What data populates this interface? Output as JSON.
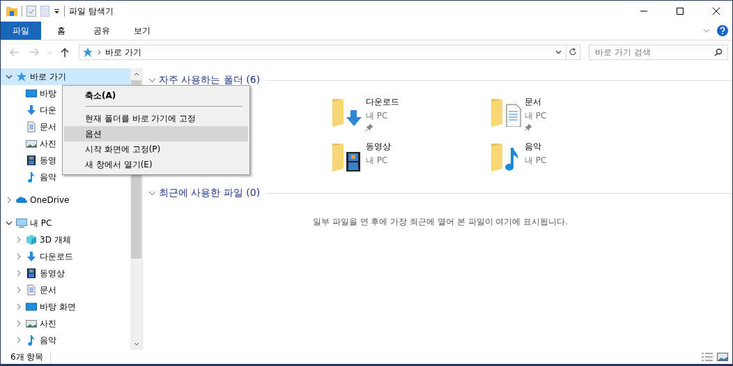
{
  "window": {
    "title": "파일 탐색기"
  },
  "ribbon": {
    "tabs": [
      {
        "label": "파일",
        "kind": "file",
        "selected": false
      },
      {
        "label": "홈",
        "kind": "tab",
        "selected": false
      },
      {
        "label": "공유",
        "kind": "tab",
        "selected": false
      },
      {
        "label": "보기",
        "kind": "tab",
        "selected": false
      }
    ]
  },
  "navigation": {
    "back_disabled": true,
    "forward_disabled": true,
    "address": "바로 가기",
    "search": {
      "placeholder": "바로 가기 검색"
    }
  },
  "sidebar": {
    "items": [
      {
        "label": "바로 가기",
        "kind": "star",
        "expanded": true,
        "selected": true,
        "children": [
          {
            "label": "바탕",
            "kind": "desktop",
            "selected": false
          },
          {
            "label": "다운",
            "kind": "download",
            "selected": false
          },
          {
            "label": "문서",
            "kind": "document",
            "selected": false
          },
          {
            "label": "사진",
            "kind": "picture",
            "selected": false
          },
          {
            "label": "동영",
            "kind": "video",
            "selected": false
          },
          {
            "label": "음악",
            "kind": "music",
            "selected": false
          }
        ]
      },
      {
        "label": "OneDrive",
        "kind": "cloud",
        "expanded": false,
        "selected": false
      },
      {
        "label": "내 PC",
        "kind": "pc",
        "expanded": true,
        "selected": false,
        "children": [
          {
            "label": "3D 개체",
            "kind": "cube",
            "expanded": false,
            "selected": false
          },
          {
            "label": "다운로드",
            "kind": "download",
            "expanded": false,
            "selected": false
          },
          {
            "label": "동영상",
            "kind": "video",
            "expanded": false,
            "selected": false
          },
          {
            "label": "문서",
            "kind": "document",
            "expanded": false,
            "selected": false
          },
          {
            "label": "바탕 화면",
            "kind": "desktop",
            "expanded": false,
            "selected": false
          },
          {
            "label": "사진",
            "kind": "picture",
            "expanded": false,
            "selected": false
          },
          {
            "label": "음악",
            "kind": "music",
            "expanded": false,
            "selected": false
          }
        ]
      }
    ]
  },
  "context_menu": {
    "items": [
      {
        "label": "축소(A)",
        "kind": "default",
        "selected": false
      },
      {
        "kind": "separator"
      },
      {
        "label": "현재 폴더를 바로 가기에 고정",
        "kind": "item",
        "selected": false
      },
      {
        "label": "옵션",
        "kind": "item",
        "selected": true
      },
      {
        "label": "시작 화면에 고정(P)",
        "kind": "item",
        "selected": false
      },
      {
        "label": "새 창에서 열기(E)",
        "kind": "item",
        "selected": false
      }
    ]
  },
  "sections": [
    {
      "title": "자주 사용하는 폴더 (6)",
      "expanded": true,
      "folders": [
        {
          "name": "다운로드",
          "location": "내 PC",
          "kind": "download",
          "pinned": true
        },
        {
          "name": "문서",
          "location": "내 PC",
          "kind": "document",
          "pinned": true
        },
        {
          "name": "동영상",
          "location": "내 PC",
          "kind": "video",
          "pinned": false
        },
        {
          "name": "음악",
          "location": "내 PC",
          "kind": "music",
          "pinned": false
        }
      ]
    },
    {
      "title": "최근에 사용한 파일 (0)",
      "expanded": true,
      "empty_message": "일부 파일을 연 후에 가장 최근에 열어 본 파일이 여기에 표시됩니다."
    }
  ],
  "status_bar": {
    "item_count": "6개 항목"
  }
}
